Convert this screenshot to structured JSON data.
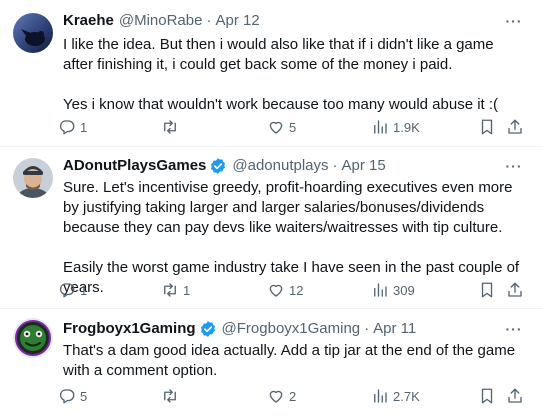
{
  "tweets": [
    {
      "name": "Kraehe",
      "handle": "@MinoRabe",
      "separator": "·",
      "date": "Apr 12",
      "verified": false,
      "paragraphs": [
        "I like the idea. But then i would also like that if i didn't like a game after finishing it, i could get back some of the money i paid.",
        "Yes i know that wouldn't work because too many would abuse it :("
      ],
      "replies": "1",
      "retweets": "",
      "likes": "5",
      "views": "1.9K"
    },
    {
      "name": "ADonutPlaysGames",
      "handle": "@adonutplays",
      "separator": "·",
      "date": "Apr 15",
      "verified": true,
      "paragraphs": [
        "Sure. Let's incentivise greedy, profit-hoarding executives even more by justifying taking larger and larger salaries/bonuses/dividends because they can pay devs like waiters/waitresses with tip culture.",
        "Easily the worst game industry take I have seen in the past couple of years."
      ],
      "replies": "1",
      "retweets": "1",
      "likes": "12",
      "views": "309"
    },
    {
      "name": "Frogboyx1Gaming",
      "handle": "@Frogboyx1Gaming",
      "separator": "·",
      "date": "Apr 11",
      "verified": true,
      "paragraphs": [
        "That's a dam good idea actually. Add a tip jar at the end of the game with a comment option."
      ],
      "replies": "5",
      "retweets": "",
      "likes": "2",
      "views": "2.7K"
    }
  ],
  "more_label": "···",
  "icons": {
    "reply": "reply-icon",
    "retweet": "retweet-icon",
    "like": "heart-icon",
    "views": "views-icon",
    "bookmark": "bookmark-icon",
    "share": "share-icon",
    "verified": "verified-badge-icon"
  },
  "colors": {
    "text": "#0f1419",
    "secondary": "#536471",
    "verified": "#1d9bf0",
    "divider": "#eff3f4"
  }
}
